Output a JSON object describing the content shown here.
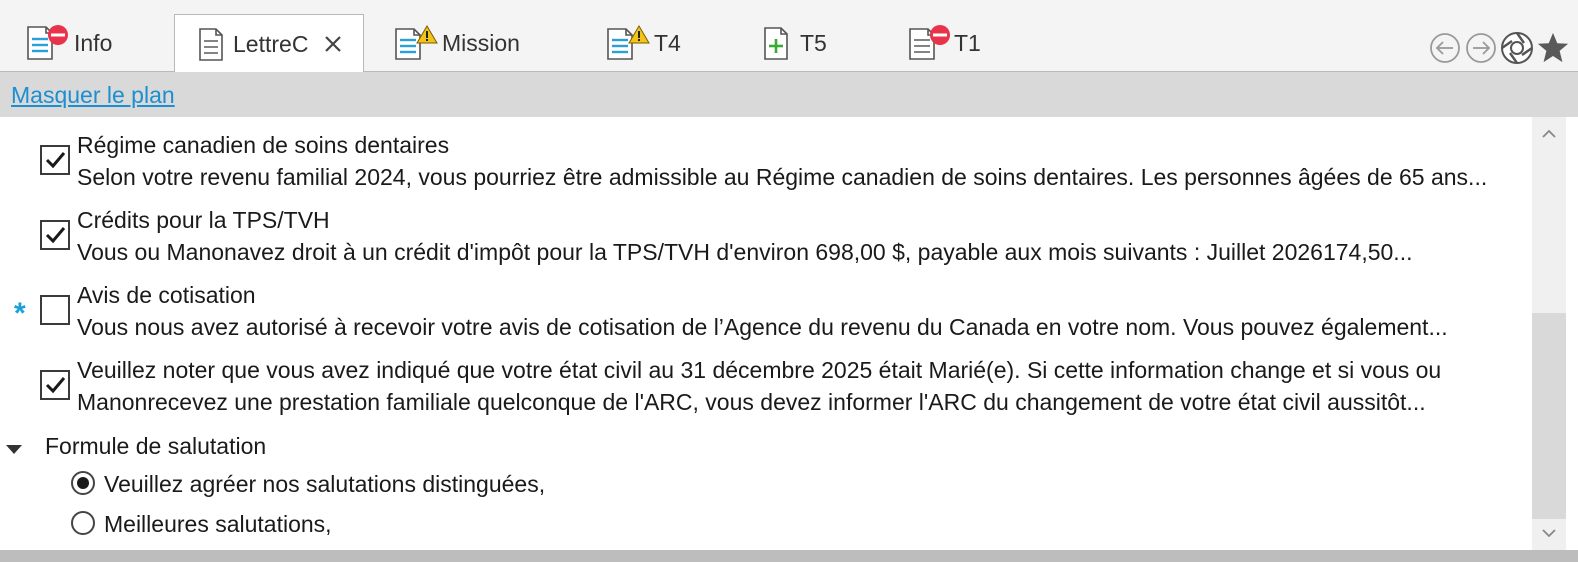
{
  "tabs": [
    {
      "label": "Info",
      "icon": "doc-blue-error-icon"
    },
    {
      "label": "LettreC",
      "icon": "doc-icon",
      "active": true
    },
    {
      "label": "Mission",
      "icon": "doc-blue-warning-icon"
    },
    {
      "label": "T4",
      "icon": "doc-blue-warning-icon"
    },
    {
      "label": "T5",
      "icon": "doc-add-icon"
    },
    {
      "label": "T1",
      "icon": "doc-error-icon"
    }
  ],
  "nav": {
    "back": "back-icon",
    "forward": "forward-icon",
    "refresh": "aperture-icon",
    "favorite": "star-icon"
  },
  "plan": {
    "toggle_label": "Masquer le plan"
  },
  "items": [
    {
      "title": "Régime canadien de soins dentaires",
      "desc": "Selon votre revenu familial 2024, vous pourriez être admissible au Régime canadien de soins dentaires. Les personnes âgées de 65 ans...",
      "checked": true
    },
    {
      "title": "Crédits pour la TPS/TVH",
      "desc": "Vous ou Manonavez droit à un crédit d'impôt pour la TPS/TVH d'environ 698,00 $, payable aux mois suivants : Juillet 2026174,50...",
      "checked": true
    },
    {
      "title": "Avis de cotisation",
      "desc": "Vous nous avez autorisé à recevoir votre avis de cotisation de l’Agence du revenu du Canada en votre nom. Vous pouvez également...",
      "checked": false,
      "required_mark": "*"
    },
    {
      "title": "Veuillez noter que vous avez indiqué que votre état civil au 31 décembre 2025 était Marié(e). Si cette information change et si vous ou",
      "desc": "Manonrecevez une prestation familiale quelconque de l'ARC, vous devez informer l'ARC du changement de votre état civil aussitôt...",
      "checked": true
    }
  ],
  "salutation": {
    "title": "Formule de salutation",
    "options": [
      {
        "label": "Veuillez agréer nos salutations distinguées,",
        "selected": true
      },
      {
        "label": "Meilleures salutations,",
        "selected": false
      }
    ]
  },
  "colors": {
    "link": "#1b8fd1",
    "required": "#1aa0d6",
    "error": "#e8334a",
    "warning": "#f2c417",
    "add": "#3aa935",
    "doc_blue": "#2a9fd8"
  }
}
